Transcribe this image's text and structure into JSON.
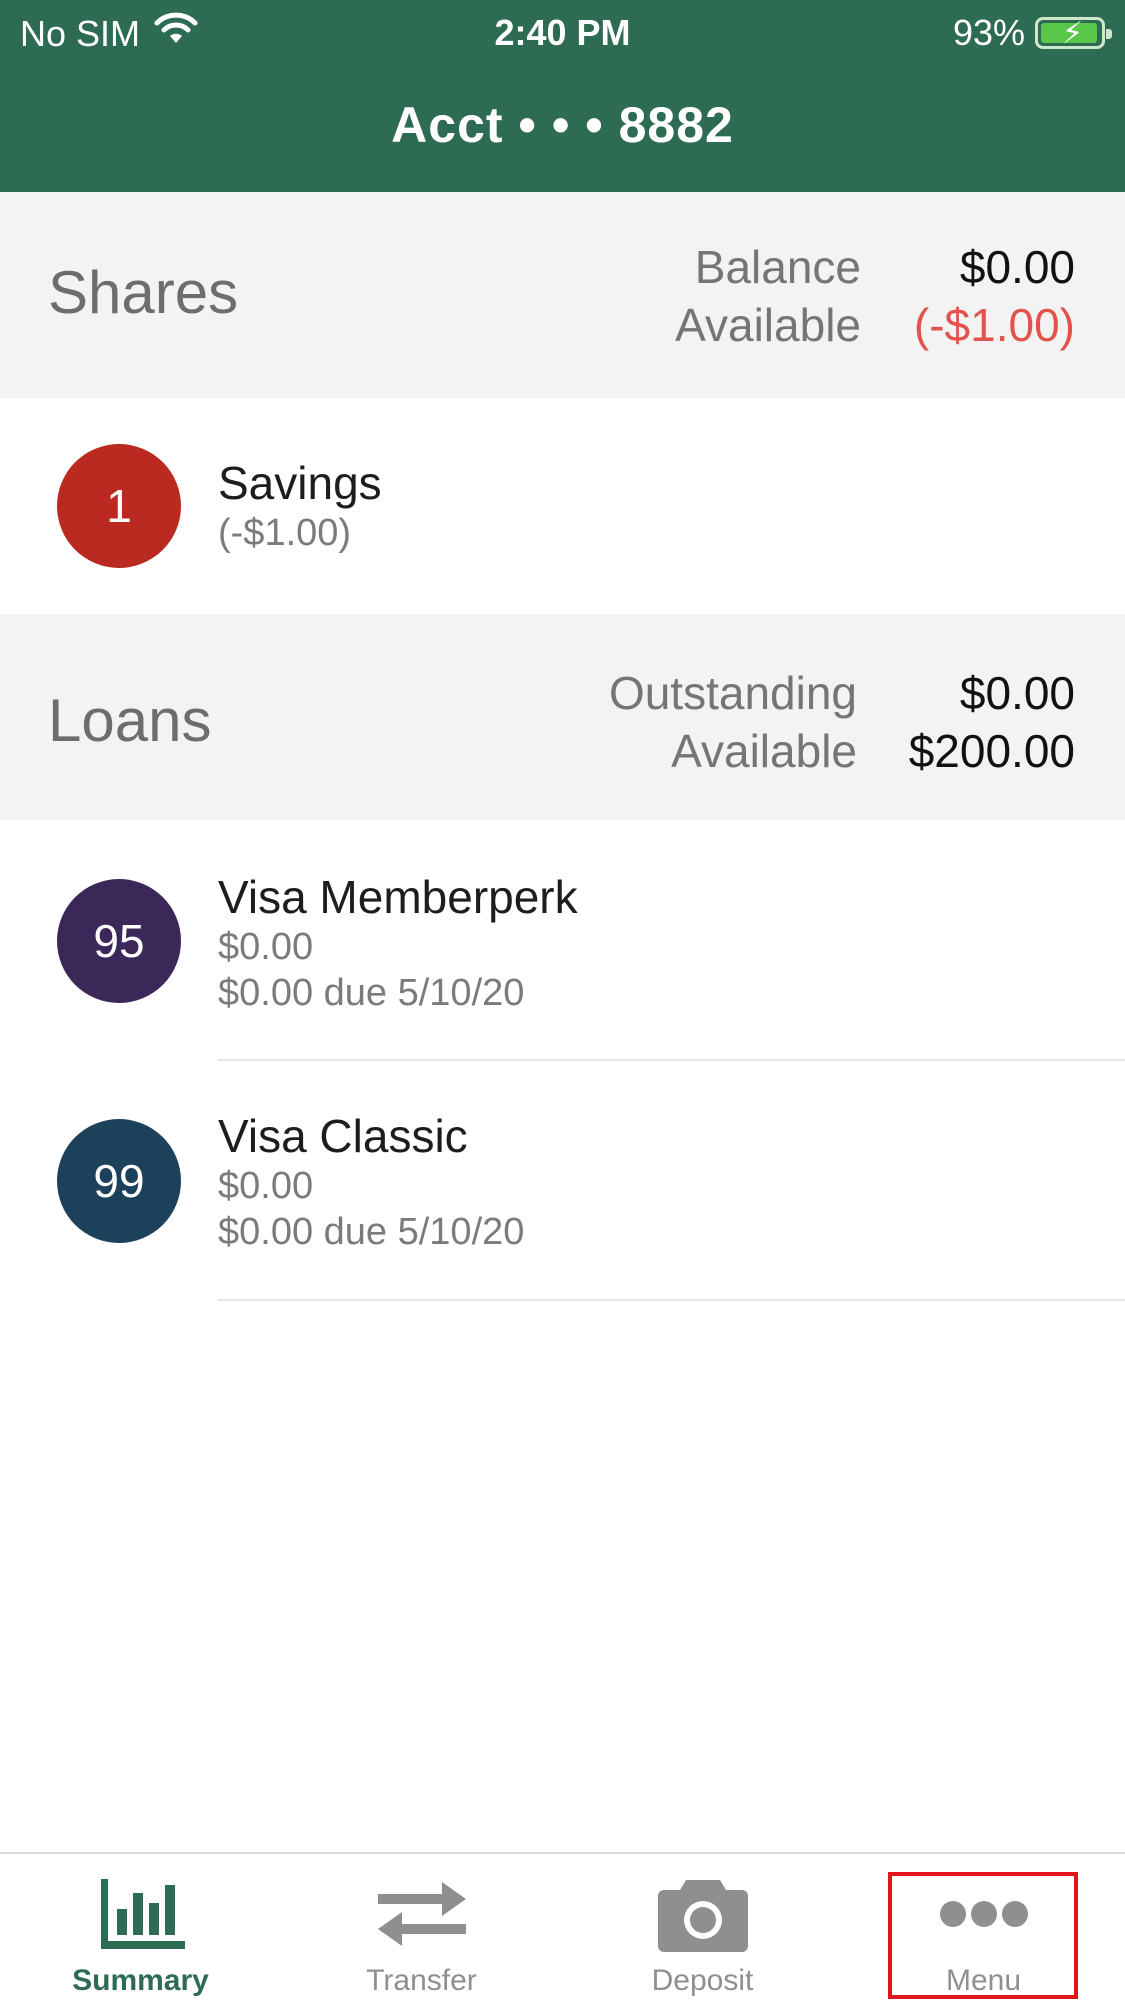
{
  "status_bar": {
    "carrier": "No SIM",
    "time": "2:40 PM",
    "battery": "93%",
    "icons": [
      "wifi-icon",
      "battery-charging-icon"
    ]
  },
  "nav": {
    "title": "Acct • • • 8882"
  },
  "shares": {
    "title": "Shares",
    "labels": [
      "Balance",
      "Available"
    ],
    "values": [
      "$0.00",
      "(-$1.00)"
    ],
    "items": [
      {
        "badge": "1",
        "badge_color": "#bb2a20",
        "name": "Savings",
        "amount": "(-$1.00)"
      }
    ]
  },
  "loans": {
    "title": "Loans",
    "labels": [
      "Outstanding",
      "Available"
    ],
    "values": [
      "$0.00",
      "$200.00"
    ],
    "items": [
      {
        "badge": "95",
        "badge_color": "#3c2759",
        "name": "Visa Memberperk",
        "amount": "$0.00",
        "due": "$0.00 due 5/10/20"
      },
      {
        "badge": "99",
        "badge_color": "#1d415b",
        "name": "Visa Classic",
        "amount": "$0.00",
        "due": "$0.00 due 5/10/20"
      }
    ]
  },
  "tabbar": {
    "tabs": [
      {
        "label": "Summary",
        "icon": "bar-chart-icon",
        "active": true
      },
      {
        "label": "Transfer",
        "icon": "transfer-arrows-icon",
        "active": false
      },
      {
        "label": "Deposit",
        "icon": "camera-icon",
        "active": false
      },
      {
        "label": "Menu",
        "icon": "more-dots-icon",
        "active": false
      }
    ]
  },
  "colors": {
    "brand_green": "#2e6b53",
    "negative_red": "#e2544b",
    "highlight_red": "#e4141c"
  }
}
